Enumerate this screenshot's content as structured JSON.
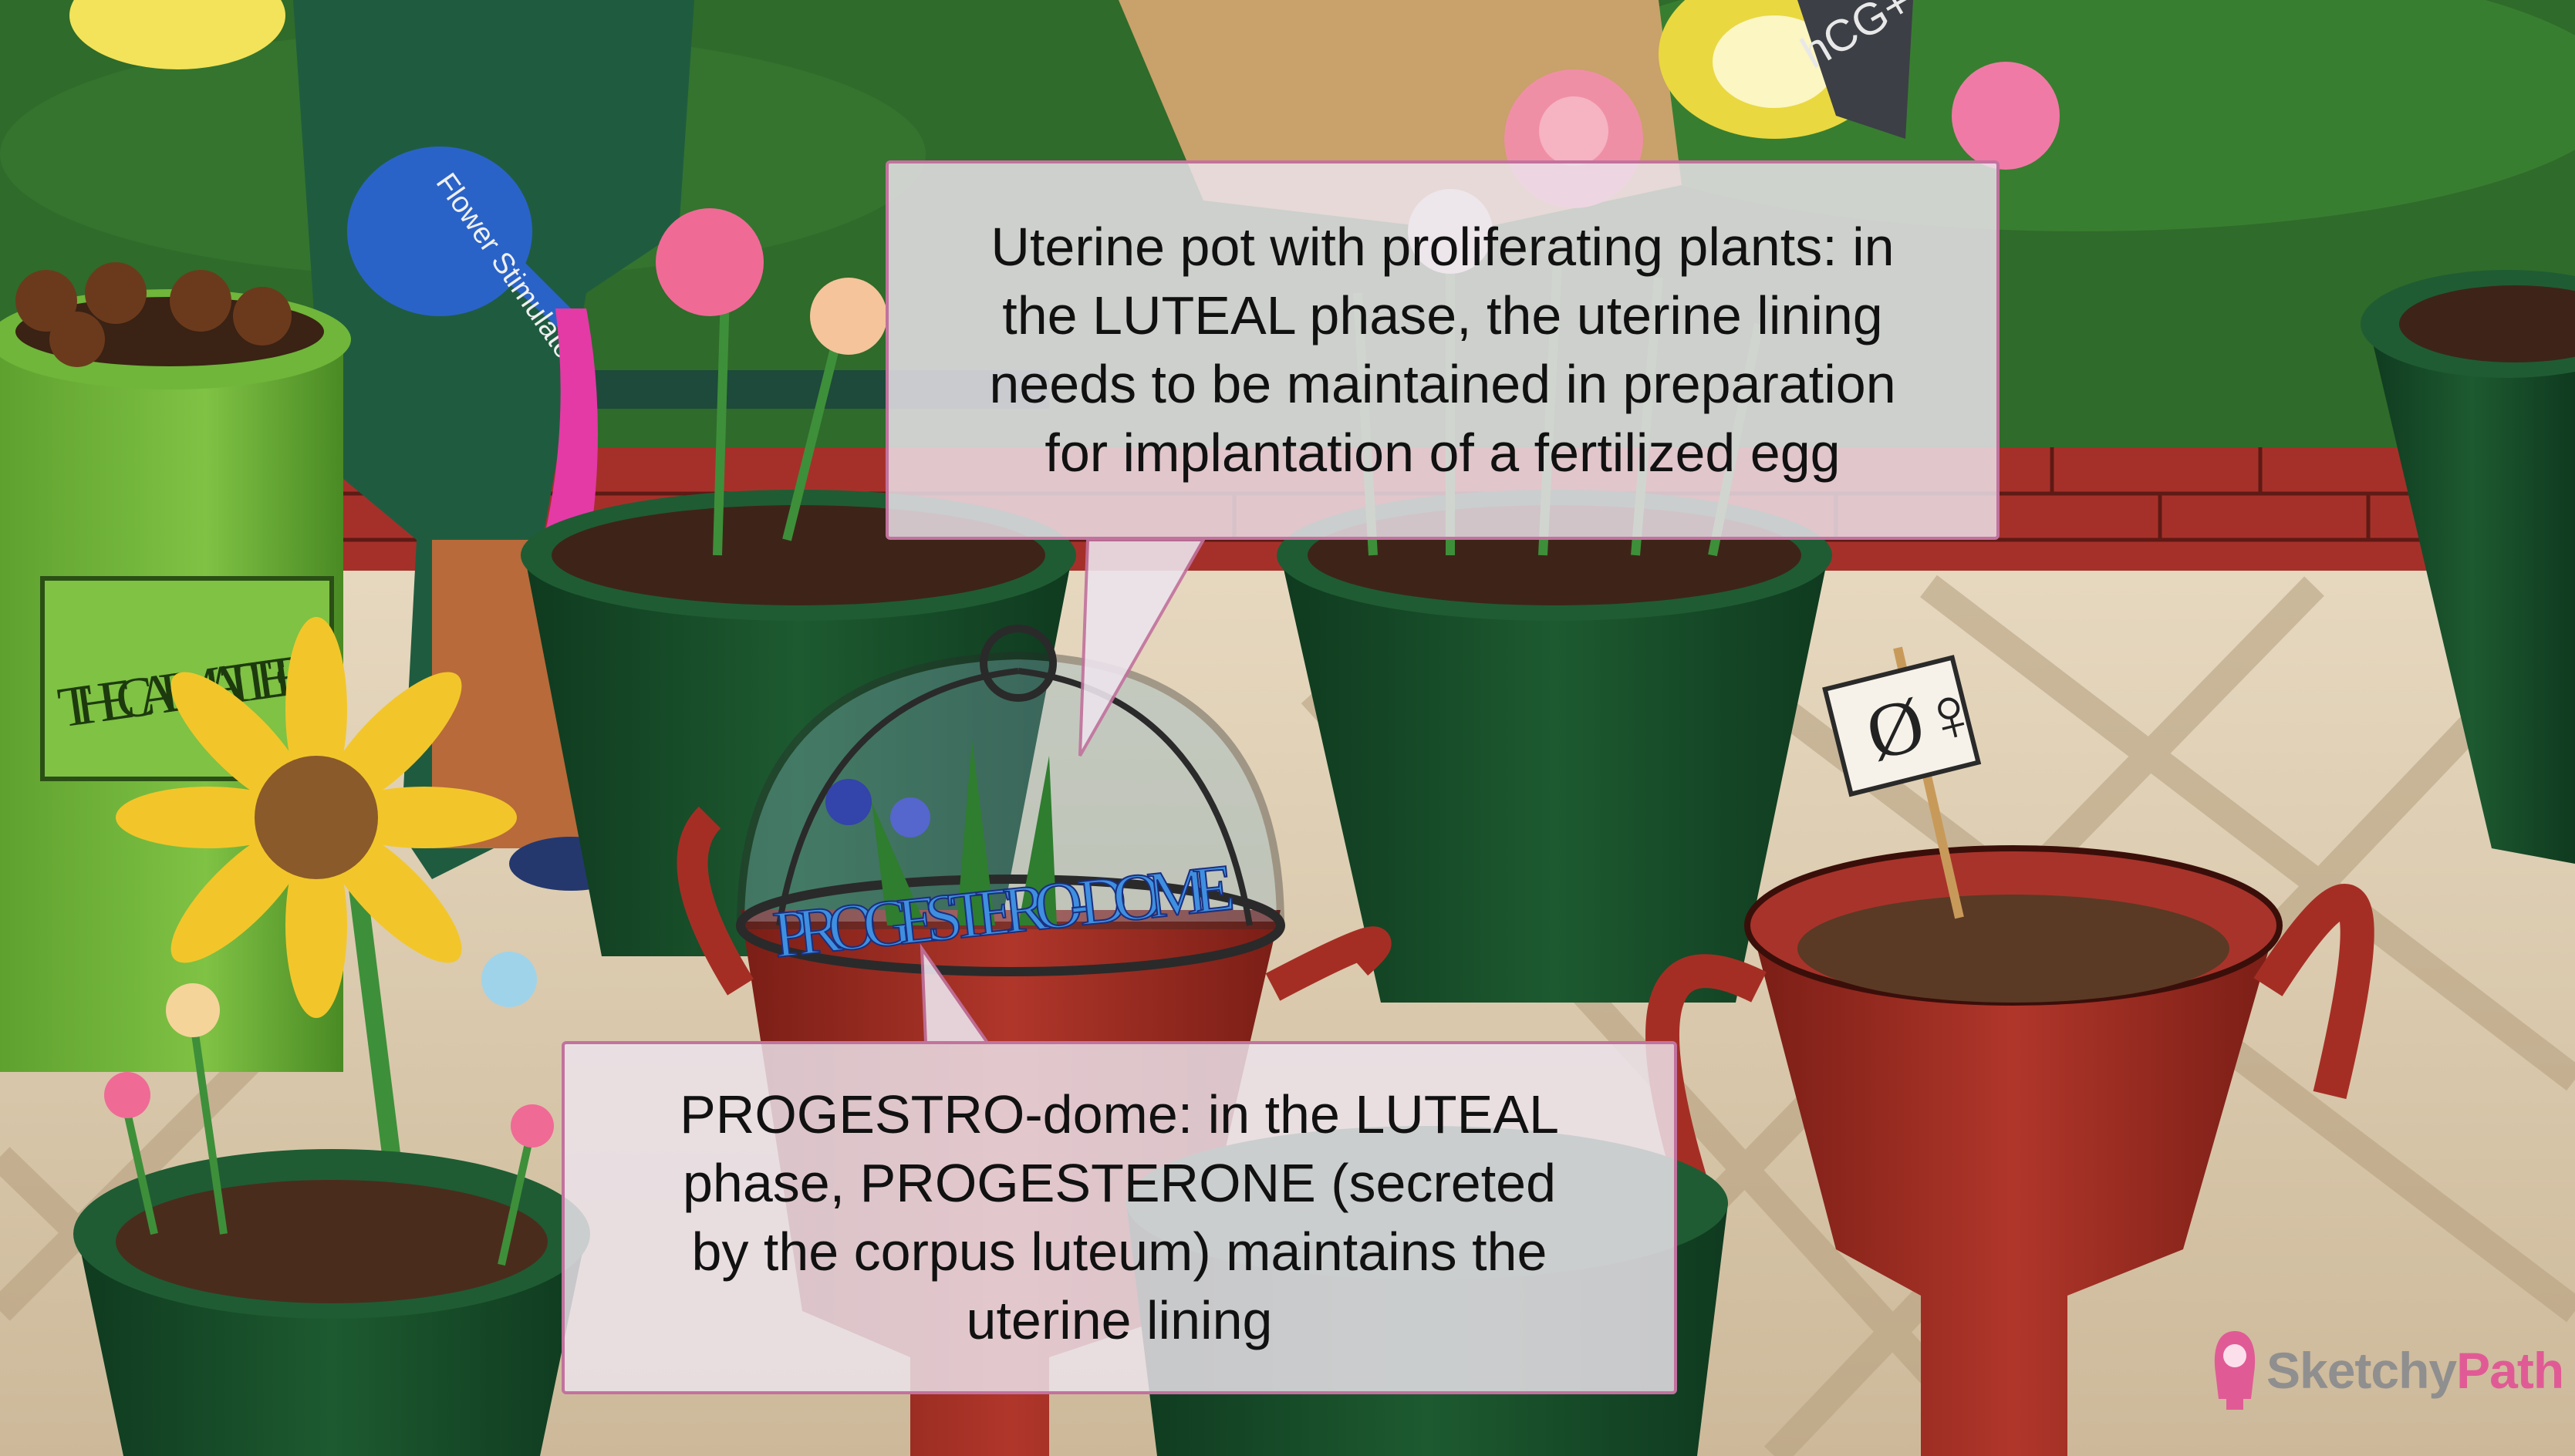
{
  "callouts": {
    "top": "Uterine pot with proliferating plants: in\nthe LUTEAL phase, the uterine lining\nneeds to be maintained in preparation\nfor implantation of a fertilized egg",
    "bottom": "PROGESTRO-dome: in the LUTEAL\nphase, PROGESTERONE (secreted\nby the corpus luteum) maintains the\nuterine lining"
  },
  "scene_labels": {
    "can_label": "THECAL MATTER",
    "dome_label": "PROGESTERO-DOME",
    "sign_label": "Ø♀",
    "watering_can_label": "Flower Stimulator",
    "lamp_label": "hCG+"
  },
  "brand": {
    "part1": "Sketchy",
    "part2": "Path"
  },
  "colors": {
    "callout_border": "#c2729e",
    "brand_pink": "#e05b95",
    "brand_gray": "#8f8f8f"
  },
  "icons": [
    "brand-logo-icon",
    "sunflower-icon",
    "lamp-icon",
    "watering-can-icon"
  ]
}
